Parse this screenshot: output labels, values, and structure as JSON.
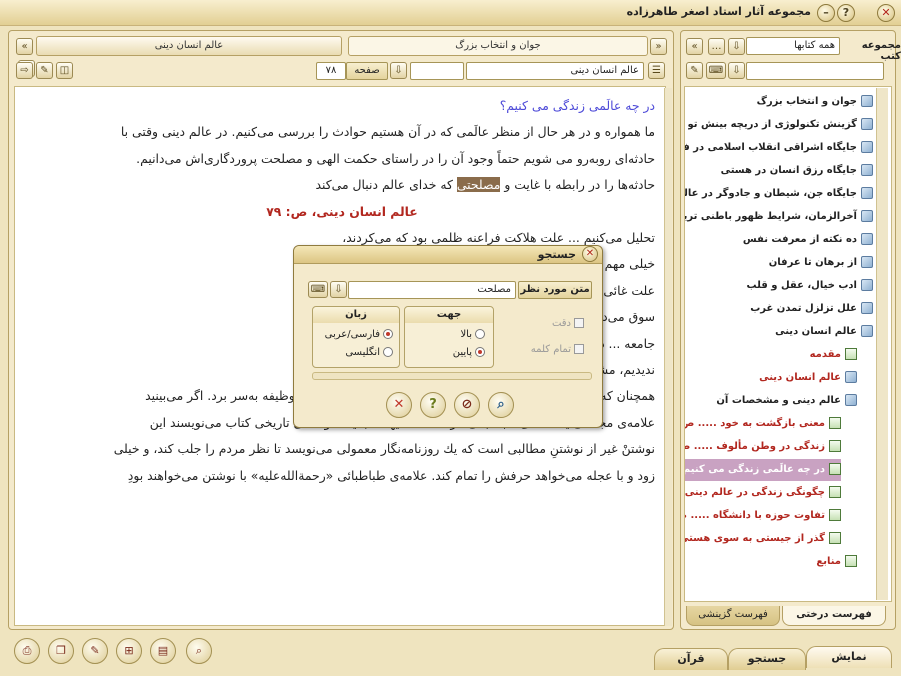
{
  "titlebar": {
    "title": "مجموعه آثار استاد اصغر طاهرزاده",
    "close_icon": "close-icon",
    "help_icon": "help-icon",
    "minimize_icon": "minimize-icon"
  },
  "doc_header": {
    "tab_left_title": "عالم انسان دینی",
    "tab_right_title": "جوان و انتخاب بزرگ",
    "book_field": "عالم انسان دینی",
    "page_label": "صفحه",
    "page_value": "۷۸"
  },
  "doc_body": {
    "question_heading": "در چه عالَمی زندگی می کنیم؟",
    "paragraph_1_line_1": "ما همواره و در هر حال از منظر عالَمی که در آن هستیم حوادث را بررسی می‌کنیم. در عالم دینی وقتی با",
    "paragraph_1_line_2": "حادثه‌ای روبه‌رو می شویم حتماً وجود آن را در راستای حکمت الهی و مصلحت پروردگاری‌اش می‌دانیم.",
    "paragraph_1_line_3_before": "حادثه‌ها را در رابطه با غایت و ",
    "paragraph_1_line_3_highlight": "مصلحتی",
    "paragraph_1_line_3_after": " که خدای عالم دنبال می‌کند",
    "source_reference": "عالم انسان دینی، ص: ۷۹",
    "paragraph_2_line_1": "تحلیل می‌کنیم ... علت هلاکت فراعنه ظلمی بود که می‌کردند،",
    "paragraph_2_line_2": "خیلی مهم ... در آن خیلی به چگونگی هلاکت‌اقوام نمی‌پردازد.",
    "paragraph_2_line_3": "علت غائی ... غایت‌نگری، انسان را به افق‌های بالای زندگی",
    "paragraph_2_line_4": "سوق می‌دهد ... رفتار خودش می‌کند. در عالَم دینی وقتی هم در",
    "paragraph_2_line_5": "جامعه ... دارید، اما همین که اجتماع را از زاویه‌ی دینی",
    "paragraph_2_line_6": "ندیدیم، مشغول غیر می شویم و از عالَم دینی خود بیرون می‌افتیم.",
    "paragraph_3_line_1": "همچنان که روشن شد برای حفظ عالَم دینی و بودن در آن عالَم باید در وظیفه به‌سر برد. اگر می‌بینید",
    "paragraph_3_line_2": "علامه‌ی مجلسی یا علامه‌ی طباطبائی «رحمة‌الله‌علیهما» با یك حوصله‌ی تاریخی کتاب می‌نویسند این",
    "paragraph_3_line_3": "نوشتنْ غیر از نوشتنِ مطالبی است که یك روزنامه‌نگار معمولی می‌نویسد تا نظر مردم را جلب کند، و خیلی",
    "paragraph_3_line_4": "زود و با عجله می‌خواهد حرفش را تمام کند. علامه‌ی طباطبائی «رحمة‌الله‌علیه» با نوشتن می‌خواهند بودِ"
  },
  "side_panel": {
    "collection_label": "مجموعه کتب",
    "collection_value": "همه کتابها",
    "tree": [
      "جوان و انتخاب بزرگ",
      "گزینش تکنولوژی از دریچه بینش تو",
      "جایگاه اشراقی انقلاب اسلامی در فط",
      "جایگاه رزق انسان در هستی",
      "جایگاه جن، شیطان و جادوگر در عالم",
      "آخرالزمان، شرایط ظهور باطنی ترین",
      "ده نکته از معرفت نفس",
      "از برهان تا عرفان",
      "ادب خیال، عقل و قلب",
      "علل تزلزل تمدن غرب",
      "عالم انسان دینی",
      "مقدمه",
      "عالم انسان دینی",
      "عالم دینی و مشخصات آن",
      "معنی بازگشت به خود ..... ص",
      "زندگی در وطن مألوف ..... ص",
      "در چه عالَمی زندگی می کنیم؟",
      "چگونگی زندگی در عالم دینی",
      "تفاوت حوزه با دانشگاه ..... ص",
      "گذر از جیستی به سوی هستی",
      "منابع"
    ],
    "tab_tree": "فهرست درختی",
    "tab_selective": "فهرست گزینشی"
  },
  "bottom_tabs": {
    "display": "نمایش",
    "search": "جستجو",
    "quran": "قرآن"
  },
  "search_dialog": {
    "title": "جستجو",
    "target_text_label": "متن مورد نظر",
    "target_text_value": "مصلحت",
    "direction_label": "جهت",
    "direction_up": "بالا",
    "direction_down": "پایین",
    "language_label": "زبان",
    "language_persian": "فارسی/عربی",
    "language_english": "انگلیسی",
    "option_exact": "دقت",
    "option_whole_word": "تمام کلمه"
  },
  "colors": {
    "accent_question": "#4d4ad8",
    "source_red": "#b2271f",
    "highlight": "#8a6c4b",
    "selected_tree": "#c9a2c2"
  }
}
